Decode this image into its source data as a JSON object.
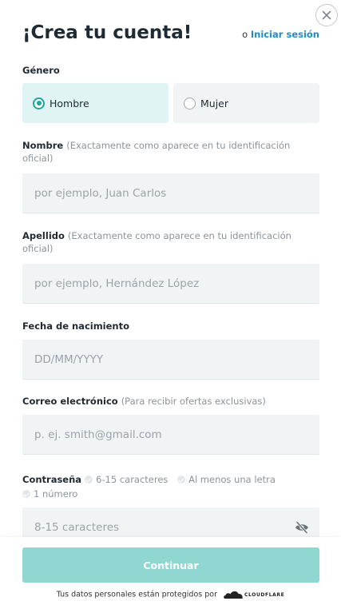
{
  "header": {
    "title": "¡Crea tu cuenta!",
    "login_prefix": "o",
    "login_link": "Iniciar sesión"
  },
  "gender": {
    "label": "Género",
    "options": [
      {
        "label": "Hombre",
        "selected": true
      },
      {
        "label": "Mujer",
        "selected": false
      }
    ]
  },
  "first_name": {
    "label": "Nombre",
    "hint": "(Exactamente como aparece en tu identificación oficial)",
    "placeholder": "por ejemplo, Juan Carlos",
    "value": ""
  },
  "last_name": {
    "label": "Apellido",
    "hint": "(Exactamente como aparece en tu identificación oficial)",
    "placeholder": "por ejemplo, Hernández López",
    "value": ""
  },
  "birth_date": {
    "label": "Fecha de nacimiento",
    "placeholder": "DD/MM/YYYY",
    "value": ""
  },
  "email": {
    "label": "Correo electrónico",
    "hint": "(Para recibir ofertas exclusivas)",
    "placeholder": "p. ej. smith@gmail.com",
    "value": ""
  },
  "password": {
    "label": "Contraseña",
    "rules": [
      "6-15 caracteres",
      "Al menos una letra",
      "1 número"
    ],
    "placeholder": "8-15 caracteres",
    "value": "",
    "toggle_icon": "eye-slash-icon"
  },
  "footer": {
    "continue_label": "Continuar",
    "protected_text": "Tus datos personales están protegidos por",
    "provider": "CLOUDFLARE"
  },
  "colors": {
    "accent": "#1aa79c",
    "link": "#1e8ccf",
    "button_disabled": "#90d6d1",
    "selected_bg": "#dff4f3",
    "field_bg": "#f1f4f5"
  }
}
